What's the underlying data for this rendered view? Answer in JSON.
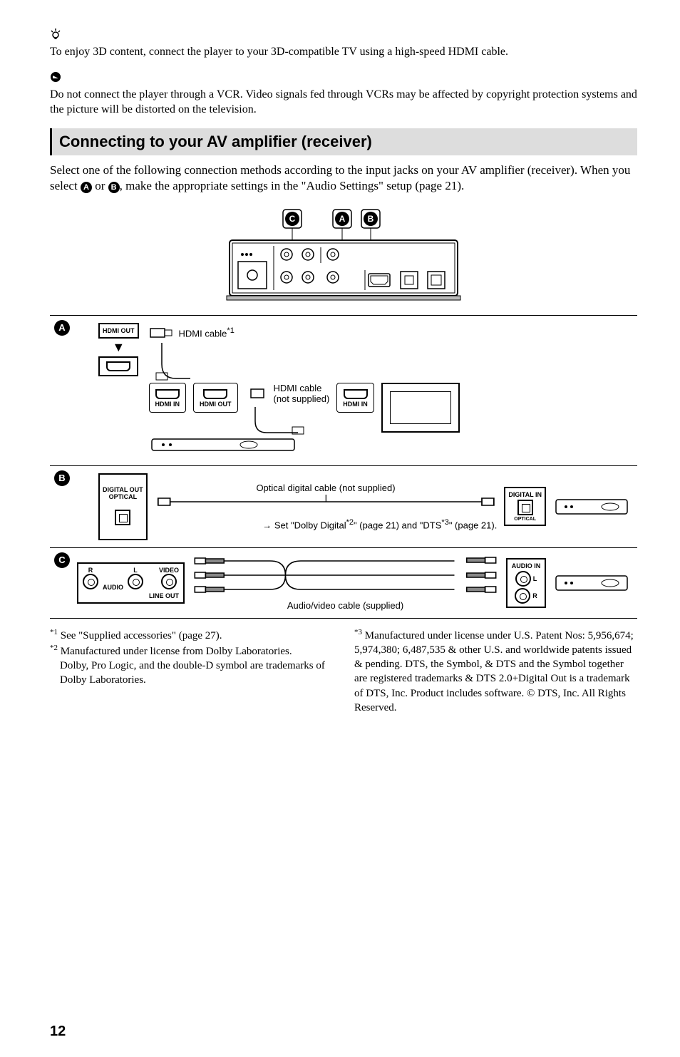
{
  "tip_text": "To enjoy 3D content, connect the player to your 3D-compatible TV using a high-speed HDMI cable.",
  "caution_text": "Do not connect the player through a VCR. Video signals fed through VCRs may be affected by copyright protection systems and the picture will be distorted on the television.",
  "section_heading": "Connecting to your AV amplifier (receiver)",
  "section_intro_1": "Select one of the following connection methods according to the input jacks on your AV amplifier (receiver). When you select ",
  "section_intro_2": " or ",
  "section_intro_3": ", make the appropriate settings in the \"Audio Settings\" setup (page 21).",
  "labels": {
    "A": "A",
    "B": "B",
    "C": "C",
    "hdmi_out": "HDMI OUT",
    "hdmi_in": "HDMI IN",
    "digital_out_optical": "DIGITAL OUT\nOPTICAL",
    "digital_in": "DIGITAL IN",
    "optical": "OPTICAL",
    "audio": "AUDIO",
    "audio_in": "AUDIO IN",
    "video": "VIDEO",
    "line_out": "LINE OUT",
    "R": "R",
    "L": "L",
    "hdmi_cable_sup": "HDMI cable",
    "sup1": "*1",
    "hdmi_cable_not_supplied": "HDMI cable\n(not supplied)",
    "optical_cable": "Optical digital cable (not supplied)",
    "dolby_dts_line_pre": "Set \"Dolby Digital",
    "sup2": "*2",
    "dolby_dts_mid": "\" (page 21) and \"DTS",
    "sup3": "*3",
    "dolby_dts_end": "\" (page 21).",
    "av_cable": "Audio/video cable (supplied)"
  },
  "footnotes": {
    "f1_mark": "*1",
    "f1_text": " See \"Supplied accessories\" (page 27).",
    "f2_mark": "*2",
    "f2_text_a": " Manufactured under license from Dolby Laboratories.",
    "f2_text_b": "Dolby, Pro Logic, and the double-D symbol are trademarks of Dolby Laboratories.",
    "f3_mark": "*3",
    "f3_text": " Manufactured under license under U.S. Patent Nos: 5,956,674; 5,974,380; 6,487,535 & other U.S. and worldwide patents issued & pending. DTS, the Symbol, & DTS and the Symbol together are registered trademarks & DTS 2.0+Digital Out is a trademark of DTS, Inc. Product includes software. © DTS, Inc. All Rights Reserved."
  },
  "page_number": "12"
}
